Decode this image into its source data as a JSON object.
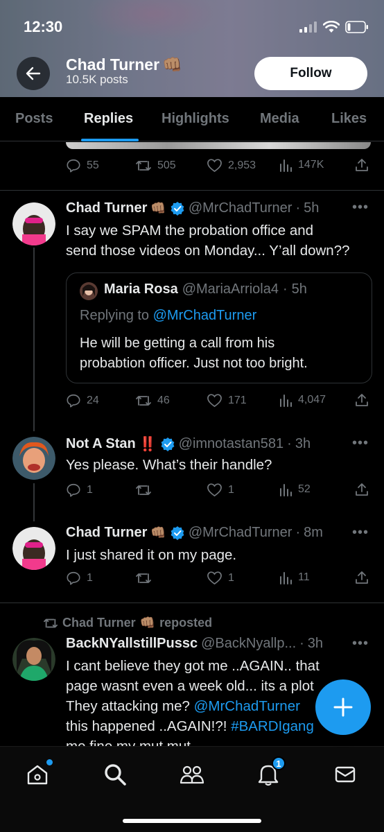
{
  "status_bar": {
    "time": "12:30"
  },
  "profile_header": {
    "name": "Chad Turner",
    "name_emoji": "👊🏽",
    "posts_count": "10.5K posts",
    "follow_label": "Follow"
  },
  "tabs": [
    {
      "label": "Posts",
      "active": false
    },
    {
      "label": "Replies",
      "active": true
    },
    {
      "label": "Highlights",
      "active": false
    },
    {
      "label": "Media",
      "active": false
    },
    {
      "label": "Likes",
      "active": false
    }
  ],
  "prev_post_actions": {
    "replies": "55",
    "reposts": "505",
    "likes": "2,953",
    "views": "147K"
  },
  "posts": [
    {
      "name": "Chad Turner",
      "emoji": "👊🏽",
      "handle": "@MrChadTurner",
      "time": "5h",
      "text_line1": "I say we SPAM the probation office and",
      "text_line2": "send those videos on Monday... Y’all down??",
      "quote": {
        "name": "Maria Rosa",
        "handle": "@MariaArriola4",
        "time": "5h",
        "replying_prefix": "Replying to",
        "replying_handle": "@MrChadTurner",
        "text_line1": "He will be getting a call from his",
        "text_line2": "probabtion officer. Just not too bright."
      },
      "actions": {
        "replies": "24",
        "reposts": "46",
        "likes": "171",
        "views": "4,047"
      }
    },
    {
      "name": "Not A Stan",
      "emoji": "‼️",
      "handle": "@imnotastan581",
      "time": "3h",
      "text_line1": "Yes please. What’s their handle?",
      "actions": {
        "replies": "1",
        "reposts": "",
        "likes": "1",
        "views": "52"
      }
    },
    {
      "name": "Chad Turner",
      "emoji": "👊🏽",
      "handle": "@MrChadTurner",
      "time": "8m",
      "text_line1": "I just shared it on my page.",
      "actions": {
        "replies": "1",
        "reposts": "",
        "likes": "1",
        "views": "11"
      }
    }
  ],
  "repost": {
    "label": "Chad Turner",
    "emoji": "👊🏽",
    "suffix": "reposted",
    "name": "BackNYallstillPussc",
    "handle": "@BackNyallp...",
    "time": "3h",
    "text_line1": "I cant believe they got me ..AGAIN.. that",
    "text_line2": "page wasnt even a week old... its a plot",
    "text_line3a": "They attacking me? ",
    "text_line3b": "@MrChadTurner",
    "text_line4a": "this happened ..AGAIN!?! ",
    "text_line4b": "#BARDIgang",
    "text_line5": "me fine my mut mut"
  },
  "bottom_nav": {
    "notification_badge": "1"
  },
  "colors": {
    "accent": "#1d9bf0",
    "verified": "#1d9bf0",
    "muted": "#71767b",
    "badge_red": "#f4212e"
  }
}
